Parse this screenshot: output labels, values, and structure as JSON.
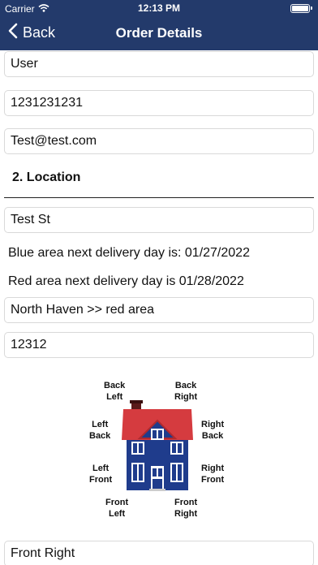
{
  "status_bar": {
    "carrier": "Carrier",
    "time": "12:13 PM"
  },
  "nav": {
    "back_label": "Back",
    "title": "Order Details"
  },
  "fields": {
    "name": "User",
    "phone": "1231231231",
    "email": "Test@test.com",
    "street": "Test St",
    "area": "North Haven >> red area",
    "zip": "12312",
    "placement": "Front Right"
  },
  "section_location": "2. Location",
  "notes": {
    "blue": "Blue area next delivery day is: 01/27/2022",
    "red": "Red area next delivery day is 01/28/2022"
  },
  "house_labels": {
    "back_left": "Back\nLeft",
    "back_right": "Back\nRight",
    "left_back": "Left\nBack",
    "right_back": "Right\nBack",
    "left_front": "Left\nFront",
    "right_front": "Right\nFront",
    "front_left": "Front\nLeft",
    "front_right": "Front\nRight"
  },
  "colors": {
    "header": "#233a6b",
    "house_body": "#1f3c8c",
    "roof": "#d53b3f"
  }
}
